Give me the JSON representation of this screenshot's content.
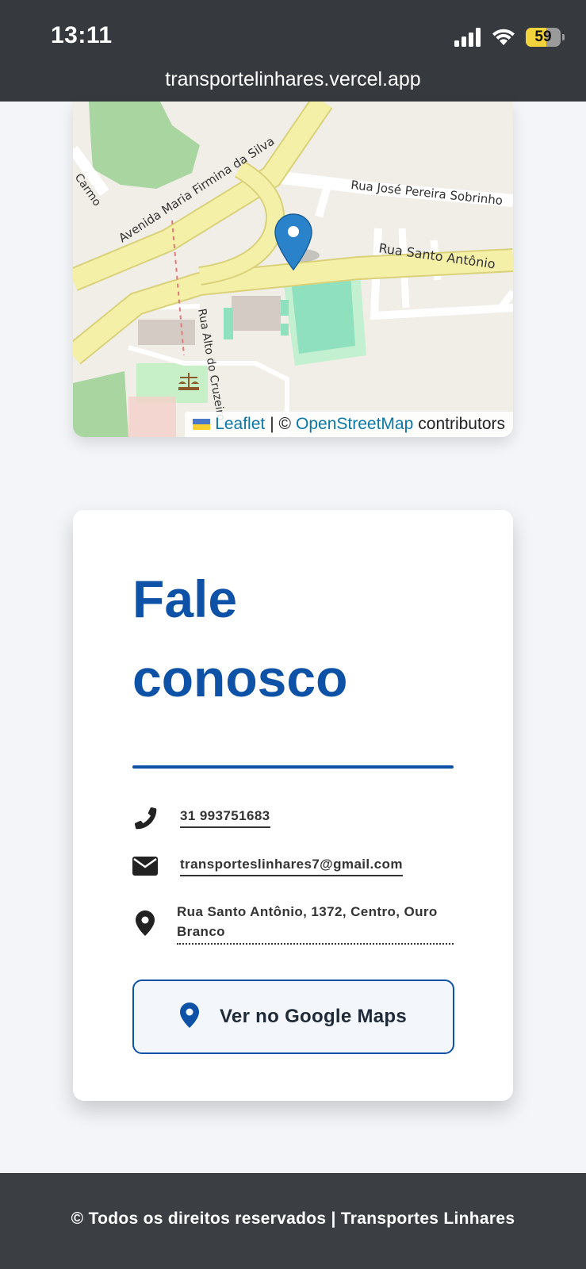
{
  "status_bar": {
    "time": "13:11",
    "battery_level": "59",
    "url": "transportelinhares.vercel.app"
  },
  "map": {
    "street_labels": [
      "Avenida Maria Firmina da Silva",
      "Rua José Pereira Sobrinho",
      "Rua Santo Antônio",
      "Rua Alto do Cruzeiro",
      "Carmo"
    ],
    "attribution": {
      "leaflet_link": "Leaflet",
      "separator": "| ©",
      "osm_link": "OpenStreetMap",
      "suffix": "contributors"
    }
  },
  "contact": {
    "title_line1": "Fale",
    "title_line2": "conosco",
    "phone": "31 993751683",
    "email": "transporteslinhares7@gmail.com",
    "address": "Rua Santo Antônio, 1372, Centro, Ouro Branco",
    "maps_button_label": "Ver no Google Maps"
  },
  "footer": {
    "text": "© Todos os direitos reservados | Transportes Linhares"
  },
  "colors": {
    "accent": "#0e52a8",
    "status_bar_bg": "#36393e",
    "footer_bg": "#3b3e43"
  }
}
